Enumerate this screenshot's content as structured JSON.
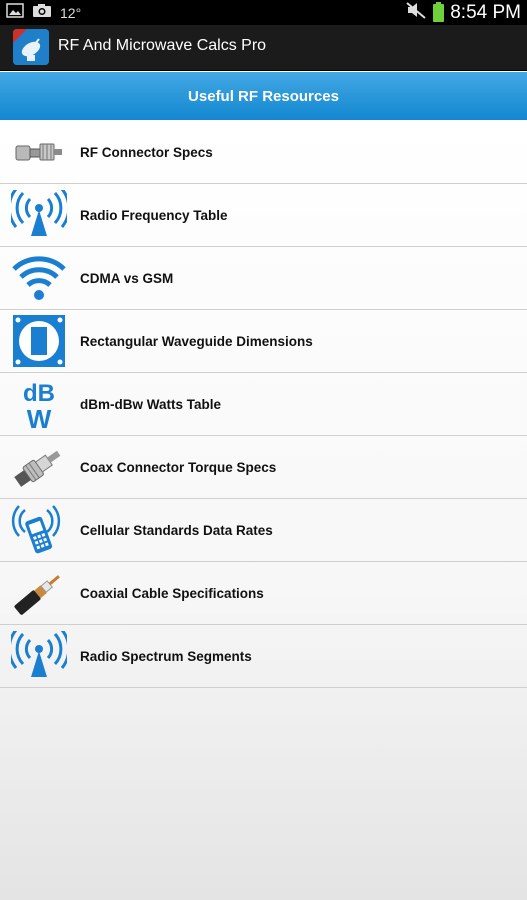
{
  "status_bar": {
    "temperature": "12°",
    "time": "8:54 PM"
  },
  "app": {
    "title": "RF And Microwave Calcs Pro",
    "badge": "PRO"
  },
  "section": {
    "title": "Useful RF Resources"
  },
  "items": [
    {
      "label": "RF Connector Specs",
      "icon": "rf-connector-icon"
    },
    {
      "label": "Radio Frequency Table",
      "icon": "antenna-tower-icon"
    },
    {
      "label": "CDMA vs GSM",
      "icon": "wifi-icon"
    },
    {
      "label": "Rectangular Waveguide Dimensions",
      "icon": "waveguide-icon"
    },
    {
      "label": "dBm-dBw Watts Table",
      "icon": "dbw-icon",
      "icon_text_top": "dB",
      "icon_text_bottom": "W"
    },
    {
      "label": "Coax Connector Torque Specs",
      "icon": "coax-connector-icon"
    },
    {
      "label": "Cellular Standards Data Rates",
      "icon": "cell-phone-icon"
    },
    {
      "label": "Coaxial Cable Specifications",
      "icon": "coaxial-cable-icon"
    },
    {
      "label": "Radio Spectrum Segments",
      "icon": "antenna-tower-icon"
    }
  ],
  "colors": {
    "accent": "#1387d0",
    "icon_blue": "#1a7fd0"
  }
}
